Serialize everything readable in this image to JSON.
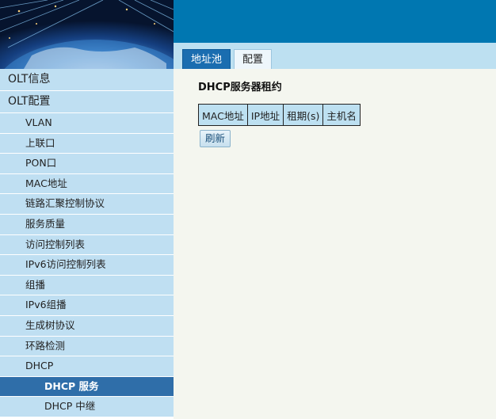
{
  "tabs": [
    {
      "label": "地址池",
      "active": true
    },
    {
      "label": "配置",
      "active": false
    }
  ],
  "sidebar": {
    "items": [
      {
        "label": "OLT信息",
        "level": 1
      },
      {
        "label": "OLT配置",
        "level": 1
      },
      {
        "label": "VLAN",
        "level": 2
      },
      {
        "label": "上联口",
        "level": 2
      },
      {
        "label": "PON口",
        "level": 2
      },
      {
        "label": "MAC地址",
        "level": 2
      },
      {
        "label": "链路汇聚控制协议",
        "level": 2
      },
      {
        "label": "服务质量",
        "level": 2
      },
      {
        "label": "访问控制列表",
        "level": 2
      },
      {
        "label": "IPv6访问控制列表",
        "level": 2
      },
      {
        "label": "组播",
        "level": 2
      },
      {
        "label": "IPv6组播",
        "level": 2
      },
      {
        "label": "生成树协议",
        "level": 2
      },
      {
        "label": "环路检测",
        "level": 2
      },
      {
        "label": "DHCP",
        "level": 2
      },
      {
        "label": "DHCP 服务",
        "level": 3,
        "active": true
      },
      {
        "label": "DHCP 中继",
        "level": 3
      }
    ]
  },
  "main": {
    "title": "DHCP服务器租约",
    "table_headers": [
      "MAC地址",
      "IP地址",
      "租期(s)",
      "主机名"
    ],
    "refresh_label": "刷新"
  },
  "colors": {
    "topbar": "#0077b1",
    "tabbar": "#bde0f1",
    "menu_bg": "#bfdff2",
    "menu_active": "#2f6ea9",
    "content_bg": "#f4f6ef"
  }
}
